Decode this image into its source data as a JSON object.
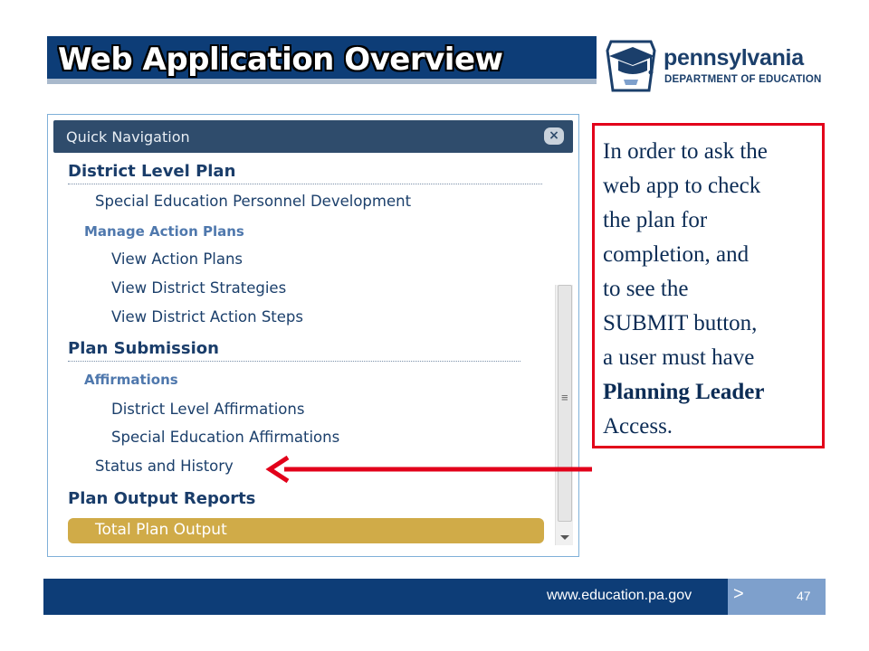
{
  "slide": {
    "title": "Web Application Overview"
  },
  "logo": {
    "brand": "pennsylvania",
    "department": "DEPARTMENT OF EDUCATION"
  },
  "quick_nav": {
    "title": "Quick Navigation",
    "close_glyph": "×",
    "items": [
      {
        "kind": "section",
        "label": "District Level Plan"
      },
      {
        "kind": "link",
        "label": "Special Education Personnel Development"
      },
      {
        "kind": "sub",
        "label": "Manage Action Plans"
      },
      {
        "kind": "link",
        "label": "View Action Plans"
      },
      {
        "kind": "link",
        "label": "View District Strategies"
      },
      {
        "kind": "link",
        "label": "View District Action Steps"
      },
      {
        "kind": "section",
        "label": "Plan Submission"
      },
      {
        "kind": "sub",
        "label": "Affirmations"
      },
      {
        "kind": "link",
        "label": "District Level Affirmations"
      },
      {
        "kind": "link",
        "label": "Special Education Affirmations"
      },
      {
        "kind": "link",
        "label": "Status and History"
      },
      {
        "kind": "section",
        "label": "Plan Output Reports"
      },
      {
        "kind": "active",
        "label": "Total Plan Output"
      }
    ],
    "scroll_grip": "≡"
  },
  "callout": {
    "lines": [
      "In order to ask the",
      "web app to check",
      "the plan for",
      "completion, and",
      "to see the",
      "SUBMIT button,",
      "a user must have"
    ],
    "bold": "Planning Leader",
    "tail": "Access",
    "tail_punct": "."
  },
  "footer": {
    "url": "www.education.pa.gov",
    "chevron": ">",
    "page_number": "47"
  },
  "colors": {
    "primary_blue": "#0d3d77",
    "accent_gold": "#d0ab48",
    "callout_red": "#e2001a"
  }
}
